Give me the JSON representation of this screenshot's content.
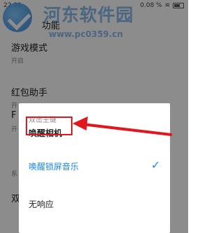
{
  "status_bar": {
    "time": "22:31",
    "speed": "0.08 %",
    "battery": ""
  },
  "watermark": {
    "title": "河东软件园",
    "url": "www.pc0359.cn"
  },
  "settings": [
    {
      "title": "功能",
      "sub": ""
    },
    {
      "title": "游戏模式",
      "sub": "开启"
    },
    {
      "title": "红包助手",
      "sub": "开"
    },
    {
      "title": "F",
      "sub": "开"
    }
  ],
  "section_labels": [
    "系",
    "双"
  ],
  "dialog": {
    "title": "双击主键",
    "options": [
      {
        "label": "唤醒相机",
        "selected": false
      },
      {
        "label": "唤醒锁屏音乐",
        "selected": true
      },
      {
        "label": "无响应",
        "selected": false
      }
    ]
  },
  "colors": {
    "accent": "#1e88e5",
    "annotation": "#e0181e"
  }
}
